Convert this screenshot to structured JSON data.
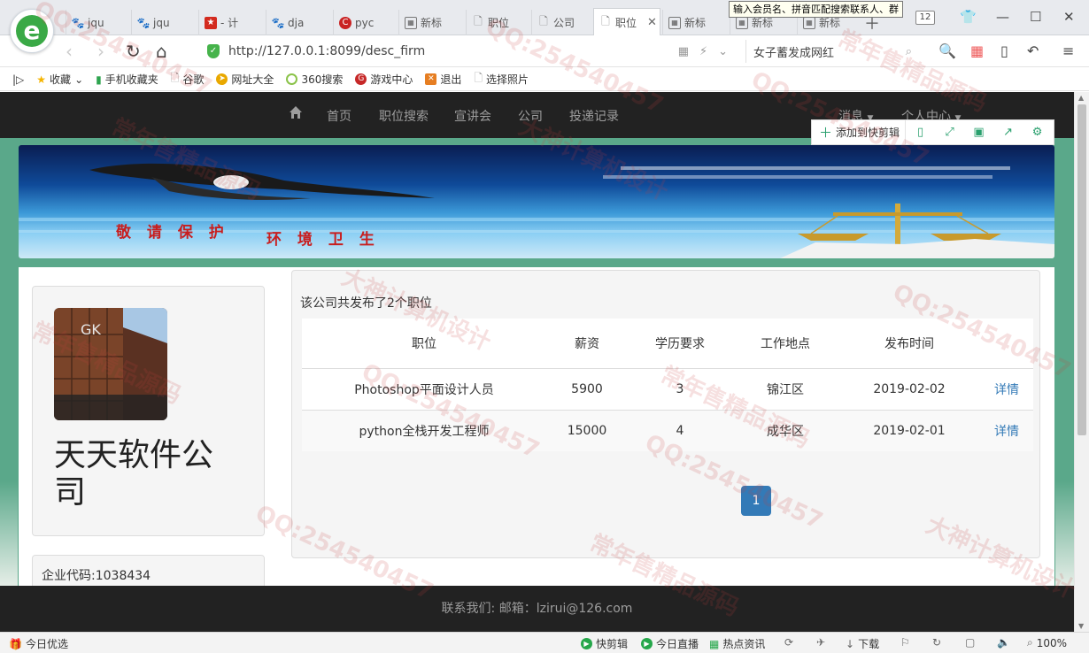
{
  "browser": {
    "tabs": [
      {
        "label": "jqu",
        "icon": "paw"
      },
      {
        "label": "jqu",
        "icon": "paw"
      },
      {
        "label": "- 计",
        "icon": "red-flag"
      },
      {
        "label": "dja",
        "icon": "paw"
      },
      {
        "label": "pyc",
        "icon": "c-red"
      },
      {
        "label": "新标",
        "icon": "grid"
      },
      {
        "label": "职位",
        "icon": "doc"
      },
      {
        "label": "公司",
        "icon": "doc"
      },
      {
        "label": "职位",
        "icon": "doc",
        "active": true
      },
      {
        "label": "新标",
        "icon": "grid"
      },
      {
        "label": "新标",
        "icon": "grid"
      },
      {
        "label": "新标",
        "icon": "grid"
      }
    ],
    "tooltip": "输入会员名、拼音匹配搜索联系人、群",
    "tab_count": "12",
    "url": "http://127.0.0.1:8099/desc_firm",
    "search_text": "女子蓄发成网红",
    "bookmarks": [
      "收藏",
      "手机收藏夹",
      "谷歌",
      "网址大全",
      "360搜索",
      "游戏中心",
      "退出",
      "选择照片"
    ],
    "status": {
      "left": "今日优选",
      "items": [
        "快剪辑",
        "今日直播",
        "热点资讯"
      ],
      "download": "下载",
      "zoom": "100%"
    }
  },
  "site": {
    "nav": {
      "items": [
        "首页",
        "职位搜索",
        "宣讲会",
        "公司",
        "投递记录"
      ],
      "right": [
        "消息",
        "个人中心"
      ]
    },
    "quick_clip": "添加到快剪辑",
    "banner_text": {
      "slogan_left": "敬 请 保 护",
      "slogan_right": "环 境 卫 生"
    },
    "company": {
      "name": "天天软件公司",
      "code_label": "企业代码:1038434"
    },
    "jobs": {
      "summary": "该公司共发布了2个职位",
      "headers": [
        "职位",
        "薪资",
        "学历要求",
        "工作地点",
        "发布时间",
        ""
      ],
      "rows": [
        {
          "title": "Photoshop平面设计人员",
          "salary": "5900",
          "edu": "3",
          "place": "锦江区",
          "date": "2019-02-02",
          "action": "详情"
        },
        {
          "title": "python全栈开发工程师",
          "salary": "15000",
          "edu": "4",
          "place": "成华区",
          "date": "2019-02-01",
          "action": "详情"
        }
      ],
      "page": "1"
    },
    "footer": "联系我们:  邮箱：lzirui@126.com"
  },
  "watermark": [
    "QQ:254540457",
    "常年售精品源码",
    "大神计算机设计"
  ],
  "colors": {
    "nav_bg": "#222222",
    "page_green": "#5aa88a",
    "link": "#337ab7",
    "logo_green": "#3aa946"
  }
}
